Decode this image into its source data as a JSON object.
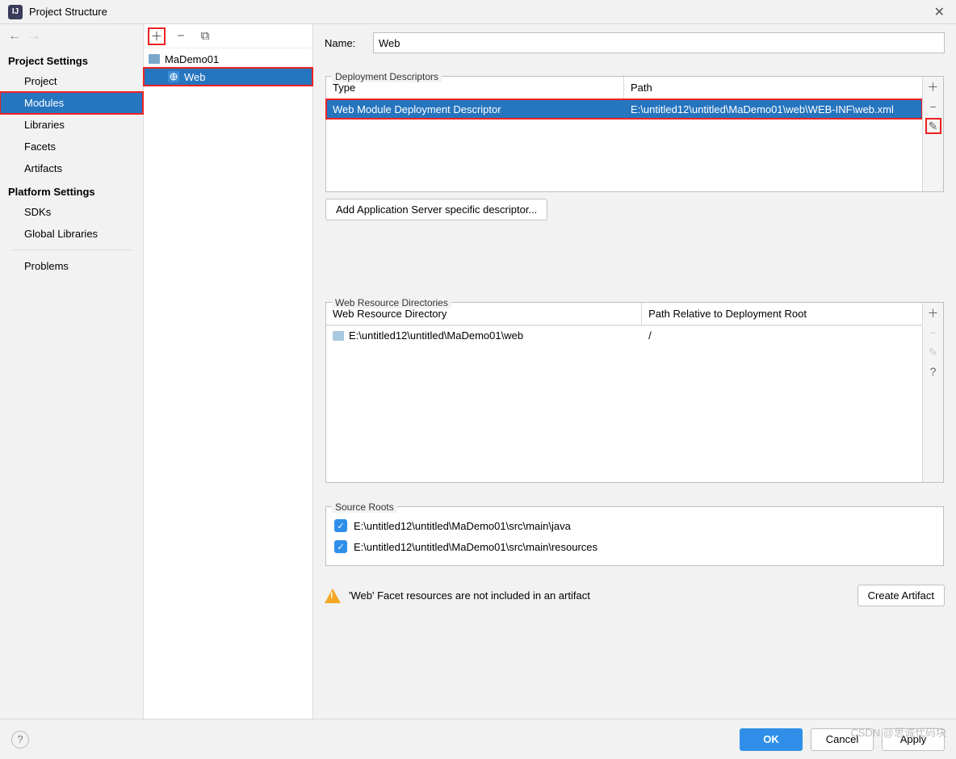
{
  "window": {
    "title": "Project Structure"
  },
  "sidebar": {
    "section1_title": "Project Settings",
    "section2_title": "Platform Settings",
    "items": {
      "project": "Project",
      "modules": "Modules",
      "libraries": "Libraries",
      "facets": "Facets",
      "artifacts": "Artifacts",
      "sdks": "SDKs",
      "global_libraries": "Global Libraries",
      "problems": "Problems"
    }
  },
  "tree": {
    "root": "MaDemo01",
    "child": "Web"
  },
  "form": {
    "name_label": "Name:",
    "name_value": "Web"
  },
  "deploy": {
    "legend": "Deployment Descriptors",
    "header_type": "Type",
    "header_path": "Path",
    "row_type": "Web Module Deployment Descriptor",
    "row_path": "E:\\untitled12\\untitled\\MaDemo01\\web\\WEB-INF\\web.xml",
    "add_server_btn": "Add Application Server specific descriptor..."
  },
  "webres": {
    "legend": "Web Resource Directories",
    "header_dir": "Web Resource Directory",
    "header_rel": "Path Relative to Deployment Root",
    "row_dir": "E:\\untitled12\\untitled\\MaDemo01\\web",
    "row_rel": "/"
  },
  "source_roots": {
    "legend": "Source Roots",
    "items": [
      "E:\\untitled12\\untitled\\MaDemo01\\src\\main\\java",
      "E:\\untitled12\\untitled\\MaDemo01\\src\\main\\resources"
    ]
  },
  "warning": {
    "text": "'Web' Facet resources are not included in an artifact",
    "create_btn": "Create Artifact"
  },
  "buttons": {
    "ok": "OK",
    "cancel": "Cancel",
    "apply": "Apply"
  },
  "watermark": "CSDN @思诚代码块"
}
